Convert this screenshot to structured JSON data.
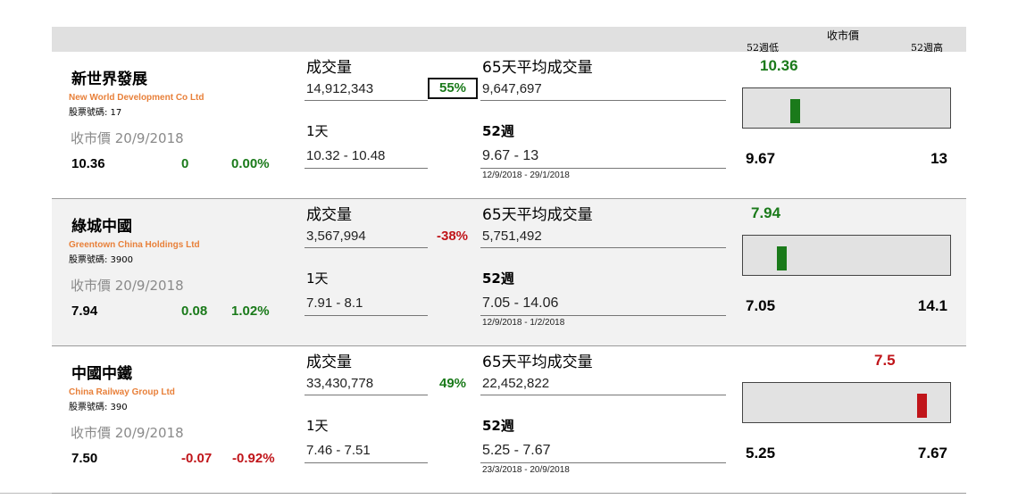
{
  "header": {
    "close_label": "收市價",
    "low_label": "52週低",
    "high_label": "52週高"
  },
  "labels": {
    "close_on": "收市價 20/9/2018",
    "volume": "成交量",
    "avg_volume": "65天平均成交量",
    "one_day": "1天",
    "week52": "52週",
    "code_prefix": "股票號碼: "
  },
  "colors": {
    "up": "#1a7a1a",
    "down": "#c0151a",
    "name_en": "#e8803a"
  },
  "stocks": [
    {
      "name_zh": "新世界發展",
      "name_en": "New World Development Co Ltd",
      "code": "股票號碼: 17",
      "close_label": "收市價 20/9/2018",
      "price": "10.36",
      "change": "0",
      "change_pct": "0.00%",
      "trend": "flat",
      "volume": "14,912,343",
      "volume_ratio": "55%",
      "ratio_trend": "up",
      "avg_volume": "9,647,697",
      "day_range": "10.32 - 10.48",
      "range_52w": "9.67 - 13",
      "range_52w_dates": "12/9/2018 - 29/1/2018",
      "last_price": "10.36",
      "low_52w": "9.67",
      "high_52w": "13",
      "position_in_range": 0.21
    },
    {
      "name_zh": "綠城中國",
      "name_en": "Greentown China Holdings Ltd",
      "code": "股票號碼: 3900",
      "close_label": "收市價 20/9/2018",
      "price": "7.94",
      "change": "0.08",
      "change_pct": "1.02%",
      "trend": "up",
      "volume": "3,567,994",
      "volume_ratio": "-38%",
      "ratio_trend": "down",
      "avg_volume": "5,751,492",
      "day_range": "7.91 - 8.1",
      "range_52w": "7.05 - 14.06",
      "range_52w_dates": "12/9/2018 - 1/2/2018",
      "last_price": "7.94",
      "low_52w": "7.05",
      "high_52w": "14.1",
      "position_in_range": 0.13
    },
    {
      "name_zh": "中國中鐵",
      "name_en": "China Railway Group Ltd",
      "code": "股票號碼: 390",
      "close_label": "收市價 20/9/2018",
      "price": "7.50",
      "change": "-0.07",
      "change_pct": "-0.92%",
      "trend": "down",
      "volume": "33,430,778",
      "volume_ratio": "49%",
      "ratio_trend": "up",
      "avg_volume": "22,452,822",
      "day_range": "7.46 - 7.51",
      "range_52w": "5.25 - 7.67",
      "range_52w_dates": "23/3/2018 - 20/9/2018",
      "last_price": "7.5",
      "low_52w": "5.25",
      "high_52w": "7.67",
      "position_in_range": 0.93
    }
  ]
}
